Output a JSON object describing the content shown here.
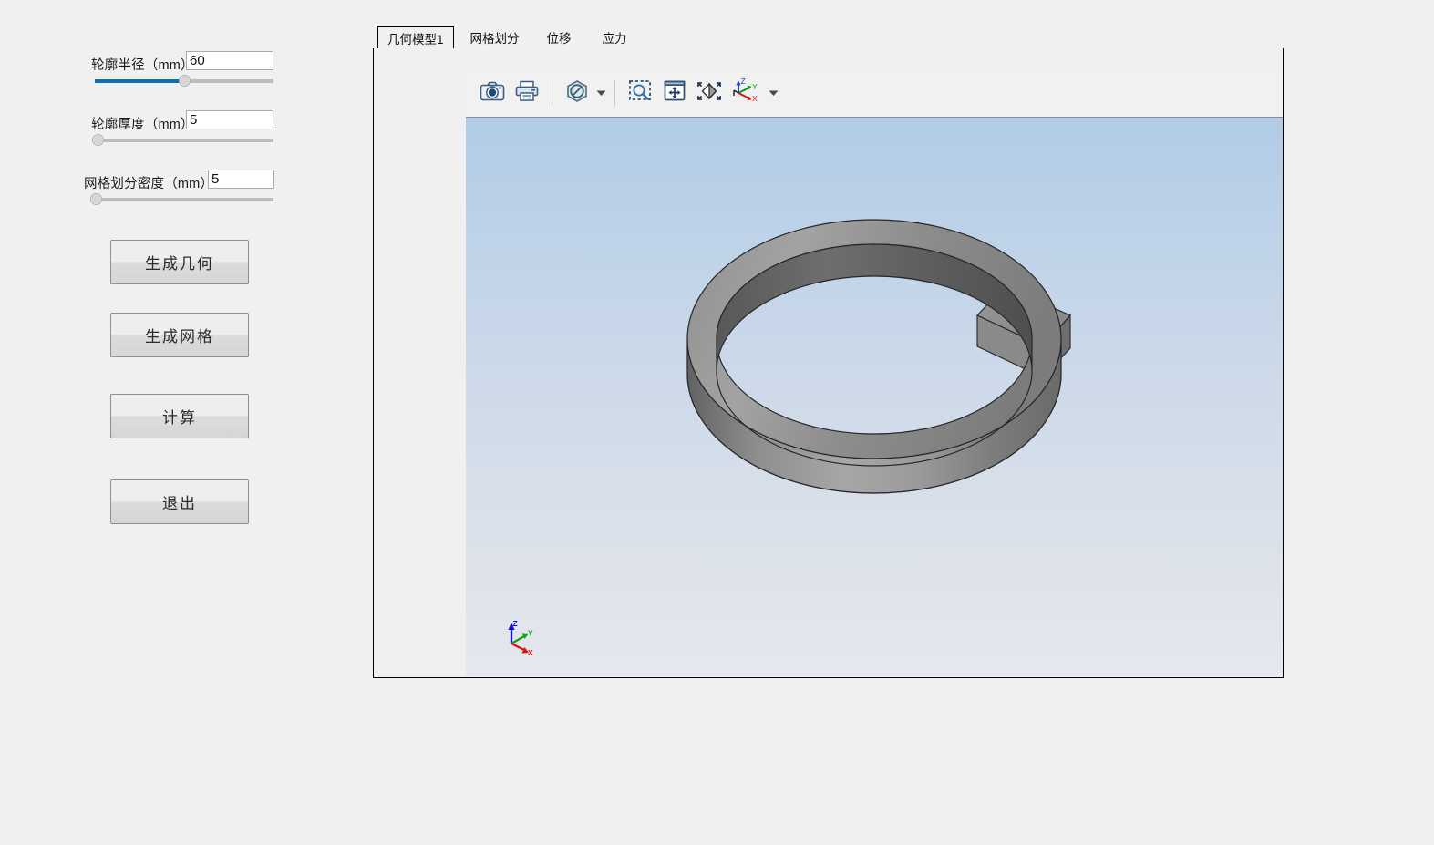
{
  "app": {
    "background_color": "#f0f0f0"
  },
  "controls": {
    "params": [
      {
        "label": "轮廓半径（mm）",
        "value": "60",
        "slider": {
          "percent": 50,
          "filled": true,
          "name": "profile-radius"
        }
      },
      {
        "label": "轮廓厚度（mm）",
        "value": "5",
        "slider": {
          "percent": 0,
          "filled": false,
          "name": "profile-thickness"
        }
      },
      {
        "label": "网格划分密度（mm）",
        "value": "5",
        "slider": {
          "percent": 0,
          "filled": false,
          "name": "mesh-density"
        }
      }
    ],
    "buttons": [
      {
        "label": "生成几何",
        "name": "generate-geometry"
      },
      {
        "label": "生成网格",
        "name": "generate-mesh"
      },
      {
        "label": "计算",
        "name": "calculate"
      },
      {
        "label": "退出",
        "name": "exit"
      }
    ]
  },
  "tabs": [
    {
      "label": "几何模型1",
      "active": true
    },
    {
      "label": "网格划分",
      "active": false
    },
    {
      "label": "位移",
      "active": false
    },
    {
      "label": "应力",
      "active": false
    }
  ],
  "viewer": {
    "toolbar": [
      {
        "name": "snapshot-icon",
        "title": "截图"
      },
      {
        "name": "print-icon",
        "title": "打印"
      },
      {
        "name": "no-display-icon",
        "title": "显示模式"
      },
      {
        "name": "no-display-dropdown-caret-icon",
        "title": "显示模式下拉"
      },
      {
        "name": "zoom-region-icon",
        "title": "框选缩放"
      },
      {
        "name": "pan-icon",
        "title": "平移"
      },
      {
        "name": "fit-view-icon",
        "title": "适合窗口"
      },
      {
        "name": "view-orientation-icon",
        "title": "视图方向"
      },
      {
        "name": "view-orientation-dropdown-caret-icon",
        "title": "视图方向下拉"
      }
    ],
    "axis_triad": {
      "x_label": "X",
      "y_label": "Y",
      "z_label": "Z",
      "x_color": "#e00000",
      "y_color": "#00a000",
      "z_color": "#0000cc"
    },
    "background_top_color": "#b2cbe6",
    "background_bottom_color": "#e5e8ed",
    "model": {
      "name": "ring-with-tab",
      "surface_color": "#8b8b8b",
      "edge_color": "#2d2d2d"
    }
  }
}
